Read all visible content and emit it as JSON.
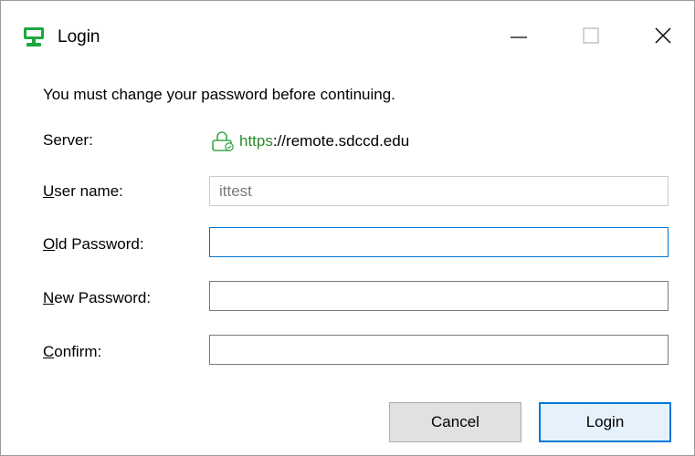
{
  "window": {
    "title": "Login",
    "icon": "green-monitor-icon",
    "controls": [
      "minimize",
      "maximize",
      "close"
    ]
  },
  "message": "You must change your password before continuing.",
  "server": {
    "label": "Server:",
    "scheme": "https",
    "rest": "://remote.sdccd.edu",
    "icon": "secure-lock-icon",
    "scheme_color": "#2a8a2a"
  },
  "username": {
    "label_accel": "U",
    "label_rest": "ser name:",
    "value": "ittest"
  },
  "old_password": {
    "label_accel": "O",
    "label_rest": "ld Password:",
    "value": ""
  },
  "new_password": {
    "label_accel": "N",
    "label_rest": "ew Password:",
    "value": ""
  },
  "confirm": {
    "label_accel": "C",
    "label_rest": "onfirm:",
    "value": ""
  },
  "buttons": {
    "cancel": "Cancel",
    "login": "Login"
  },
  "colors": {
    "accent": "#0078d7"
  }
}
